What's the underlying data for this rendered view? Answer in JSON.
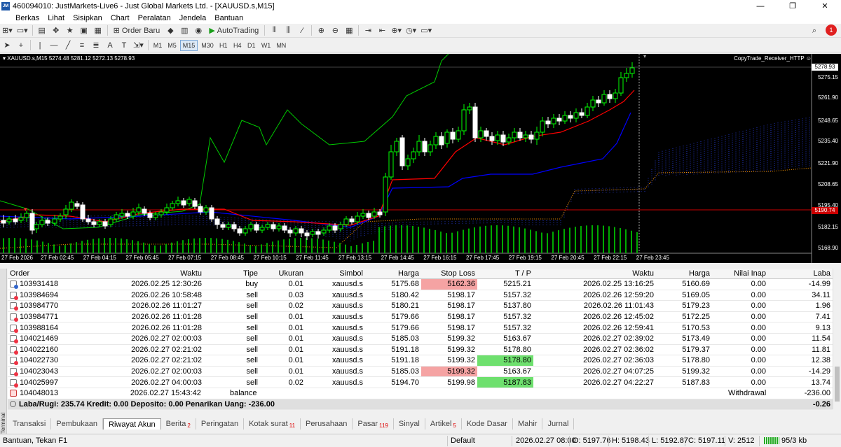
{
  "window": {
    "app_icon": "JM",
    "title": "460094010: JustMarkets-Live6 - Just Global Markets Ltd. - [XAUUSD.s,M15]",
    "minimize": "—",
    "maximize": "❐",
    "close": "✕"
  },
  "menu": [
    "Berkas",
    "Lihat",
    "Sisipkan",
    "Chart",
    "Peralatan",
    "Jendela",
    "Bantuan"
  ],
  "toolbar": {
    "new_order": "Order Baru",
    "autotrading": "AutoTrading",
    "timeframes": [
      "M1",
      "M5",
      "M15",
      "M30",
      "H1",
      "H4",
      "D1",
      "W1",
      "MN"
    ],
    "active_timeframe": "M15",
    "notification_count": "1"
  },
  "chart": {
    "header": "XAUUSD.s,M15  5274.48 5281.12 5272.13 5278.93",
    "expert": "CopyTrade_Receiver_HTTP",
    "current_price": "5278.93",
    "line_price": "5190.74",
    "price_ticks": [
      "5275.15",
      "5261.90",
      "5248.65",
      "5235.40",
      "5221.90",
      "5208.65",
      "5195.40",
      "5182.15",
      "5168.90"
    ],
    "time_ticks": [
      "27 Feb 2026",
      "27 Feb 02:45",
      "27 Feb 04:15",
      "27 Feb 05:45",
      "27 Feb 07:15",
      "27 Feb 08:45",
      "27 Feb 10:15",
      "27 Feb 11:45",
      "27 Feb 13:15",
      "27 Feb 14:45",
      "27 Feb 16:15",
      "27 Feb 17:45",
      "27 Feb 19:15",
      "27 Feb 20:45",
      "27 Feb 22:15",
      "27 Feb 23:45"
    ],
    "colors": {
      "bull": "#00ff00",
      "bear": "#ffffff",
      "tenkan": "#ff0000",
      "kijun": "#0000ff",
      "chikou": "#00cc00",
      "price_line": "#cc0000"
    }
  },
  "history": {
    "columns": [
      "Order",
      "Waktu",
      "Tipe",
      "Ukuran",
      "Simbol",
      "Harga",
      "Stop Loss",
      "T / P",
      "Waktu",
      "Harga",
      "Nilai Inap",
      "Laba"
    ],
    "rows": [
      {
        "order": "103931418",
        "open_time": "2026.02.25 12:30:26",
        "type": "buy",
        "size": "0.01",
        "symbol": "xauusd.s",
        "open_price": "5175.68",
        "sl": "5162.36",
        "tp": "5215.21",
        "close_time": "2026.02.25 13:16:25",
        "close_price": "5160.69",
        "swap": "0.00",
        "profit": "-14.99",
        "sl_hit": true,
        "tp_hit": false
      },
      {
        "order": "103984694",
        "open_time": "2026.02.26 10:58:48",
        "type": "sell",
        "size": "0.03",
        "symbol": "xauusd.s",
        "open_price": "5180.42",
        "sl": "5198.17",
        "tp": "5157.32",
        "close_time": "2026.02.26 12:59:20",
        "close_price": "5169.05",
        "swap": "0.00",
        "profit": "34.11",
        "sl_hit": false,
        "tp_hit": false
      },
      {
        "order": "103984770",
        "open_time": "2026.02.26 11:01:27",
        "type": "sell",
        "size": "0.02",
        "symbol": "xauusd.s",
        "open_price": "5180.21",
        "sl": "5198.17",
        "tp": "5137.80",
        "close_time": "2026.02.26 11:01:43",
        "close_price": "5179.23",
        "swap": "0.00",
        "profit": "1.96",
        "sl_hit": false,
        "tp_hit": false
      },
      {
        "order": "103984771",
        "open_time": "2026.02.26 11:01:28",
        "type": "sell",
        "size": "0.01",
        "symbol": "xauusd.s",
        "open_price": "5179.66",
        "sl": "5198.17",
        "tp": "5157.32",
        "close_time": "2026.02.26 12:45:02",
        "close_price": "5172.25",
        "swap": "0.00",
        "profit": "7.41",
        "sl_hit": false,
        "tp_hit": false
      },
      {
        "order": "103988164",
        "open_time": "2026.02.26 11:01:28",
        "type": "sell",
        "size": "0.01",
        "symbol": "xauusd.s",
        "open_price": "5179.66",
        "sl": "5198.17",
        "tp": "5157.32",
        "close_time": "2026.02.26 12:59:41",
        "close_price": "5170.53",
        "swap": "0.00",
        "profit": "9.13",
        "sl_hit": false,
        "tp_hit": false
      },
      {
        "order": "104021469",
        "open_time": "2026.02.27 02:00:03",
        "type": "sell",
        "size": "0.01",
        "symbol": "xauusd.s",
        "open_price": "5185.03",
        "sl": "5199.32",
        "tp": "5163.67",
        "close_time": "2026.02.27 02:39:02",
        "close_price": "5173.49",
        "swap": "0.00",
        "profit": "11.54",
        "sl_hit": false,
        "tp_hit": false
      },
      {
        "order": "104022160",
        "open_time": "2026.02.27 02:21:02",
        "type": "sell",
        "size": "0.01",
        "symbol": "xauusd.s",
        "open_price": "5191.18",
        "sl": "5199.32",
        "tp": "5178.80",
        "close_time": "2026.02.27 02:36:02",
        "close_price": "5179.37",
        "swap": "0.00",
        "profit": "11.81",
        "sl_hit": false,
        "tp_hit": false
      },
      {
        "order": "104022730",
        "open_time": "2026.02.27 02:21:02",
        "type": "sell",
        "size": "0.01",
        "symbol": "xauusd.s",
        "open_price": "5191.18",
        "sl": "5199.32",
        "tp": "5178.80",
        "close_time": "2026.02.27 02:36:03",
        "close_price": "5178.80",
        "swap": "0.00",
        "profit": "12.38",
        "sl_hit": false,
        "tp_hit": true
      },
      {
        "order": "104023043",
        "open_time": "2026.02.27 02:00:03",
        "type": "sell",
        "size": "0.01",
        "symbol": "xauusd.s",
        "open_price": "5185.03",
        "sl": "5199.32",
        "tp": "5163.67",
        "close_time": "2026.02.27 04:07:25",
        "close_price": "5199.32",
        "swap": "0.00",
        "profit": "-14.29",
        "sl_hit": true,
        "tp_hit": false
      },
      {
        "order": "104025997",
        "open_time": "2026.02.27 04:00:03",
        "type": "sell",
        "size": "0.02",
        "symbol": "xauusd.s",
        "open_price": "5194.70",
        "sl": "5199.98",
        "tp": "5187.83",
        "close_time": "2026.02.27 04:22:27",
        "close_price": "5187.83",
        "swap": "0.00",
        "profit": "13.74",
        "sl_hit": false,
        "tp_hit": true
      }
    ],
    "balance_row": {
      "order": "104048013",
      "time": "2026.02.27 15:43:42",
      "type": "balance",
      "comment": "Withdrawal",
      "profit": "-236.00"
    },
    "summary": {
      "text": "Laba/Rugi: 235.74  Kredit: 0.00  Deposito: 0.00  Penarikan Uang: -236.00",
      "total": "-0.26"
    }
  },
  "terminal_label": "Terminal",
  "tabs": [
    {
      "label": "Transaksi",
      "badge": ""
    },
    {
      "label": "Pembukaan",
      "badge": ""
    },
    {
      "label": "Riwayat Akun",
      "badge": "",
      "active": true
    },
    {
      "label": "Berita",
      "badge": "2"
    },
    {
      "label": "Peringatan",
      "badge": ""
    },
    {
      "label": "Kotak surat",
      "badge": "11"
    },
    {
      "label": "Perusahaan",
      "badge": ""
    },
    {
      "label": "Pasar",
      "badge": "119"
    },
    {
      "label": "Sinyal",
      "badge": ""
    },
    {
      "label": "Artikel",
      "badge": "5"
    },
    {
      "label": "Kode Dasar",
      "badge": ""
    },
    {
      "label": "Mahir",
      "badge": ""
    },
    {
      "label": "Jurnal",
      "badge": ""
    }
  ],
  "status": {
    "help": "Bantuan, Tekan F1",
    "profile": "Default",
    "datetime": "2026.02.27 08:00",
    "open": "O: 5197.76",
    "high": "H: 5198.43",
    "low": "L: 5192.87",
    "close": "C: 5197.11",
    "volume": "V: 2512",
    "traffic": "95/3 kb"
  }
}
